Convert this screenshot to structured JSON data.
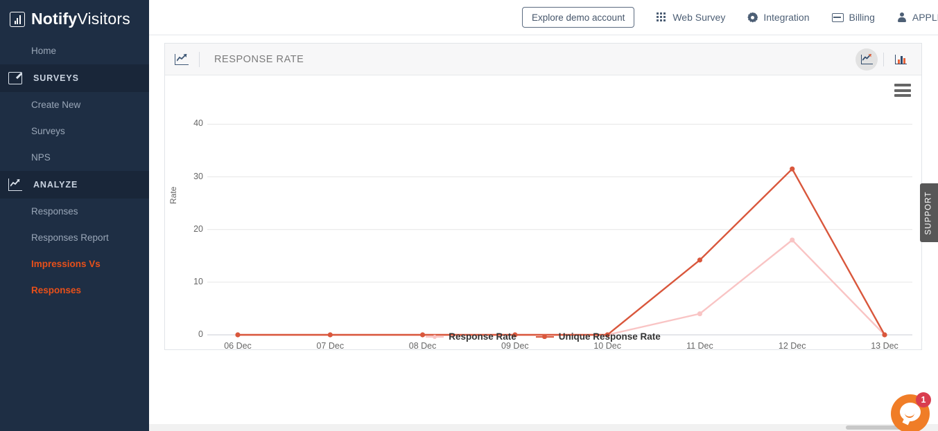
{
  "brand": {
    "bold": "Notify",
    "light": "Visitors",
    "logo_icon": "chart-logo-icon"
  },
  "sidebar": {
    "home": {
      "label": "Home"
    },
    "sections": [
      {
        "label": "SURVEYS",
        "icon": "edit-square-icon",
        "items": [
          {
            "label": "Create New",
            "active": false
          },
          {
            "label": "Surveys",
            "active": false
          },
          {
            "label": "NPS",
            "active": false
          }
        ]
      },
      {
        "label": "ANALYZE",
        "icon": "line-chart-icon",
        "items": [
          {
            "label": "Responses",
            "active": false
          },
          {
            "label": "Responses Report",
            "active": false
          },
          {
            "label": "Impressions Vs Responses",
            "active": true
          }
        ]
      }
    ],
    "active_color": "#e8501a"
  },
  "topbar": {
    "demo_button": "Explore demo account",
    "items": [
      {
        "label": "Web Survey",
        "icon": "grid-apps-icon"
      },
      {
        "label": "Integration",
        "icon": "gear-icon"
      },
      {
        "label": "Billing",
        "icon": "credit-card-icon"
      },
      {
        "label": "APPLE",
        "icon": "user-person-icon"
      }
    ]
  },
  "card": {
    "title": "RESPONSE RATE",
    "header_icon": "line-chart-icon",
    "toggles": [
      {
        "name": "line-chart-view",
        "icon": "line-chart-icon",
        "active": true
      },
      {
        "name": "bar-chart-view",
        "icon": "bar-chart-icon",
        "active": false
      }
    ],
    "export_menu_icon": "hamburger-menu-icon"
  },
  "support_tab": {
    "label": "SUPPORT"
  },
  "chat": {
    "badge": "1",
    "icon": "chat-bubble-icon"
  },
  "chart_data": {
    "type": "line",
    "title": "RESPONSE RATE",
    "xlabel": "",
    "ylabel": "Rate",
    "categories": [
      "06 Dec",
      "07 Dec",
      "08 Dec",
      "09 Dec",
      "10 Dec",
      "11 Dec",
      "12 Dec",
      "13 Dec"
    ],
    "yticks": [
      0,
      10,
      20,
      30,
      40
    ],
    "ylim": [
      0,
      44
    ],
    "grid": true,
    "legend_position": "bottom",
    "series": [
      {
        "name": "Response Rate",
        "color": "#f9c4c4",
        "values": [
          0,
          0,
          0,
          0,
          0,
          4,
          18,
          0
        ]
      },
      {
        "name": "Unique Response Rate",
        "color": "#d9573c",
        "values": [
          0,
          0,
          0,
          0,
          0,
          14.2,
          31.5,
          0
        ]
      }
    ]
  }
}
